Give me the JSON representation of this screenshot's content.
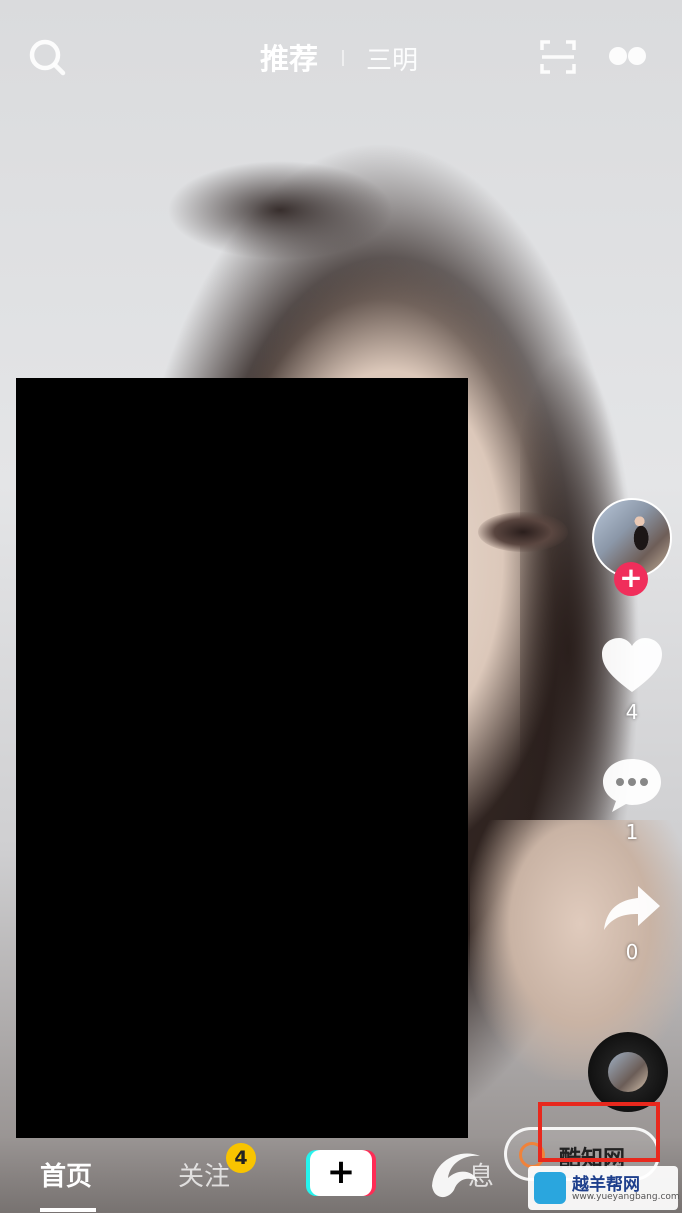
{
  "header": {
    "tab_recommend": "推荐",
    "tab_city": "三明"
  },
  "side_rail": {
    "like_count": "4",
    "comment_count": "1",
    "share_count": "0"
  },
  "bottom_nav": {
    "home": "首页",
    "follow": "关注",
    "follow_badge": "4",
    "create": "+",
    "message_partial": "息"
  },
  "watermarks": {
    "badge_text": "酷知网",
    "site_name": "越羊帮网",
    "site_url": "www.yueyangbang.com"
  },
  "colors": {
    "accent_red": "#f02e5b",
    "badge_yellow": "#f8c400",
    "cyan": "#25f4ee",
    "pink": "#fe2c55",
    "highlight_box": "#e8281d"
  },
  "icons": [
    "search-icon",
    "scan-icon",
    "live-icon",
    "heart-icon",
    "comment-icon",
    "share-icon",
    "music-disc-icon",
    "plus-icon"
  ]
}
